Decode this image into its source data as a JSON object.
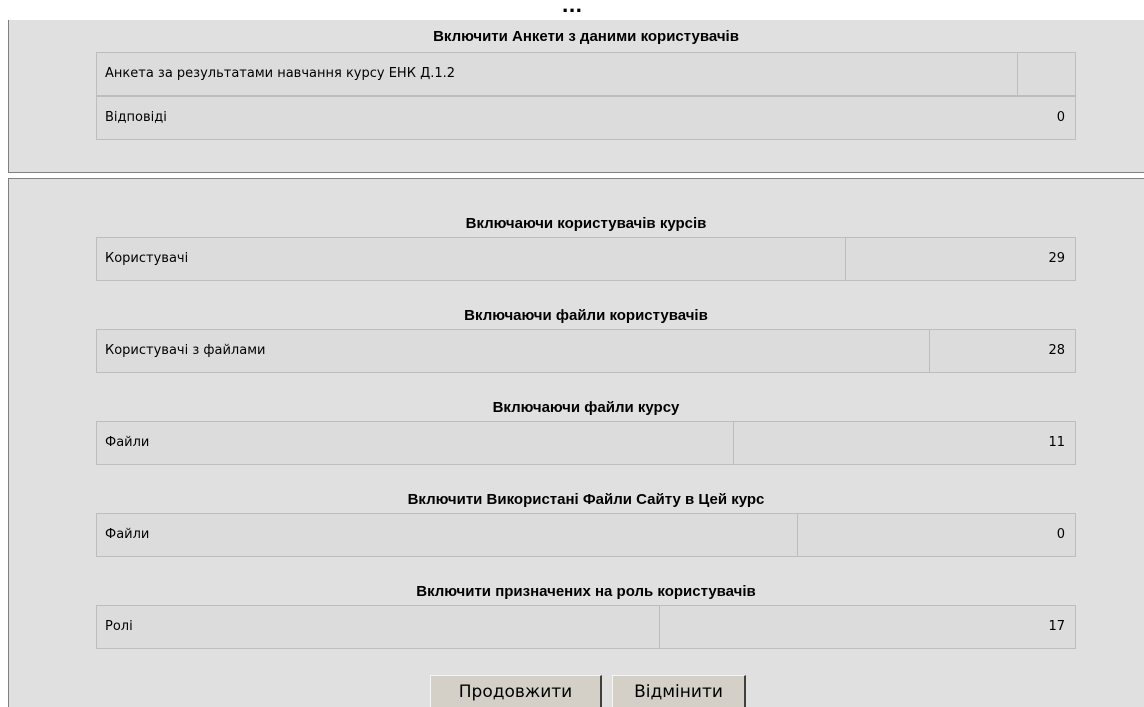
{
  "header": {
    "ellipsis": "..."
  },
  "survey_section": {
    "heading": "Включити Анкети з даними користувачів",
    "rows": [
      {
        "label": "Анкета за результатами навчання курсу ЕНК Д.1.2",
        "value": ""
      },
      {
        "label": "Відповіді",
        "value": "0"
      }
    ]
  },
  "sections": [
    {
      "heading": "Включаючи користувачів курсів",
      "label": "Користувачі",
      "value": "29"
    },
    {
      "heading": "Включаючи файли користувачів",
      "label": "Користувачі з файлами",
      "value": "28"
    },
    {
      "heading": "Включаючи файли курсу",
      "label": "Файли",
      "value": "11"
    },
    {
      "heading": "Включити Використані Файли Сайту в Цей курс",
      "label": "Файли",
      "value": "0"
    },
    {
      "heading": "Включити призначених на роль користувачів",
      "label": "Ролі",
      "value": "17"
    }
  ],
  "buttons": {
    "continue": "Продовжити",
    "cancel": "Відмінити"
  }
}
